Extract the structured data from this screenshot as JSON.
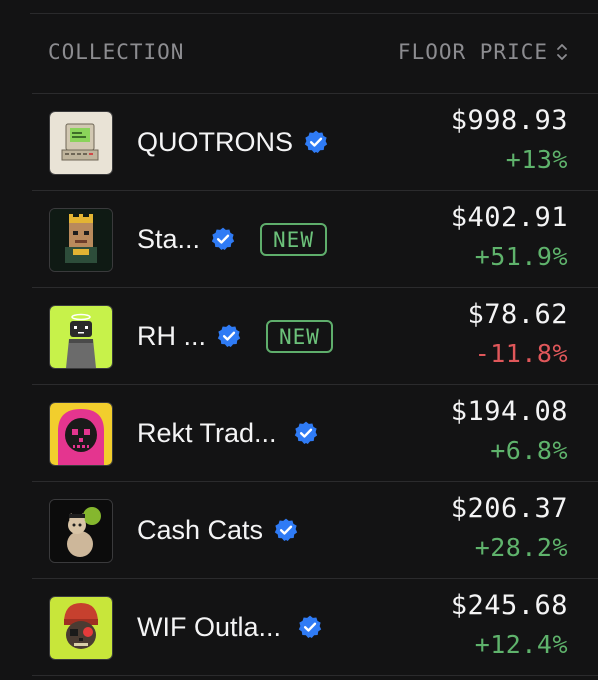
{
  "header": {
    "collection_label": "COLLECTION",
    "floor_price_label": "FLOOR PRICE"
  },
  "rows": [
    {
      "name": "QUOTRONS",
      "verified": true,
      "badge": "",
      "price": "$998.93",
      "change": "+13%",
      "direction": "up"
    },
    {
      "name": "Sta...",
      "verified": true,
      "badge": "NEW",
      "price": "$402.91",
      "change": "+51.9%",
      "direction": "up"
    },
    {
      "name": "RH ...",
      "verified": true,
      "badge": "NEW",
      "price": "$78.62",
      "change": "-11.8%",
      "direction": "down"
    },
    {
      "name": "Rekt Trad...",
      "verified": true,
      "badge": "",
      "price": "$194.08",
      "change": "+6.8%",
      "direction": "up"
    },
    {
      "name": "Cash Cats",
      "verified": true,
      "badge": "",
      "price": "$206.37",
      "change": "+28.2%",
      "direction": "up"
    },
    {
      "name": "WIF Outla...",
      "verified": true,
      "badge": "",
      "price": "$245.68",
      "change": "+12.4%",
      "direction": "up"
    }
  ],
  "colors": {
    "background": "#131314",
    "positive": "#5fb36c",
    "negative": "#e0575a",
    "verified": "#2f7bf5",
    "muted": "#8c8c90"
  }
}
